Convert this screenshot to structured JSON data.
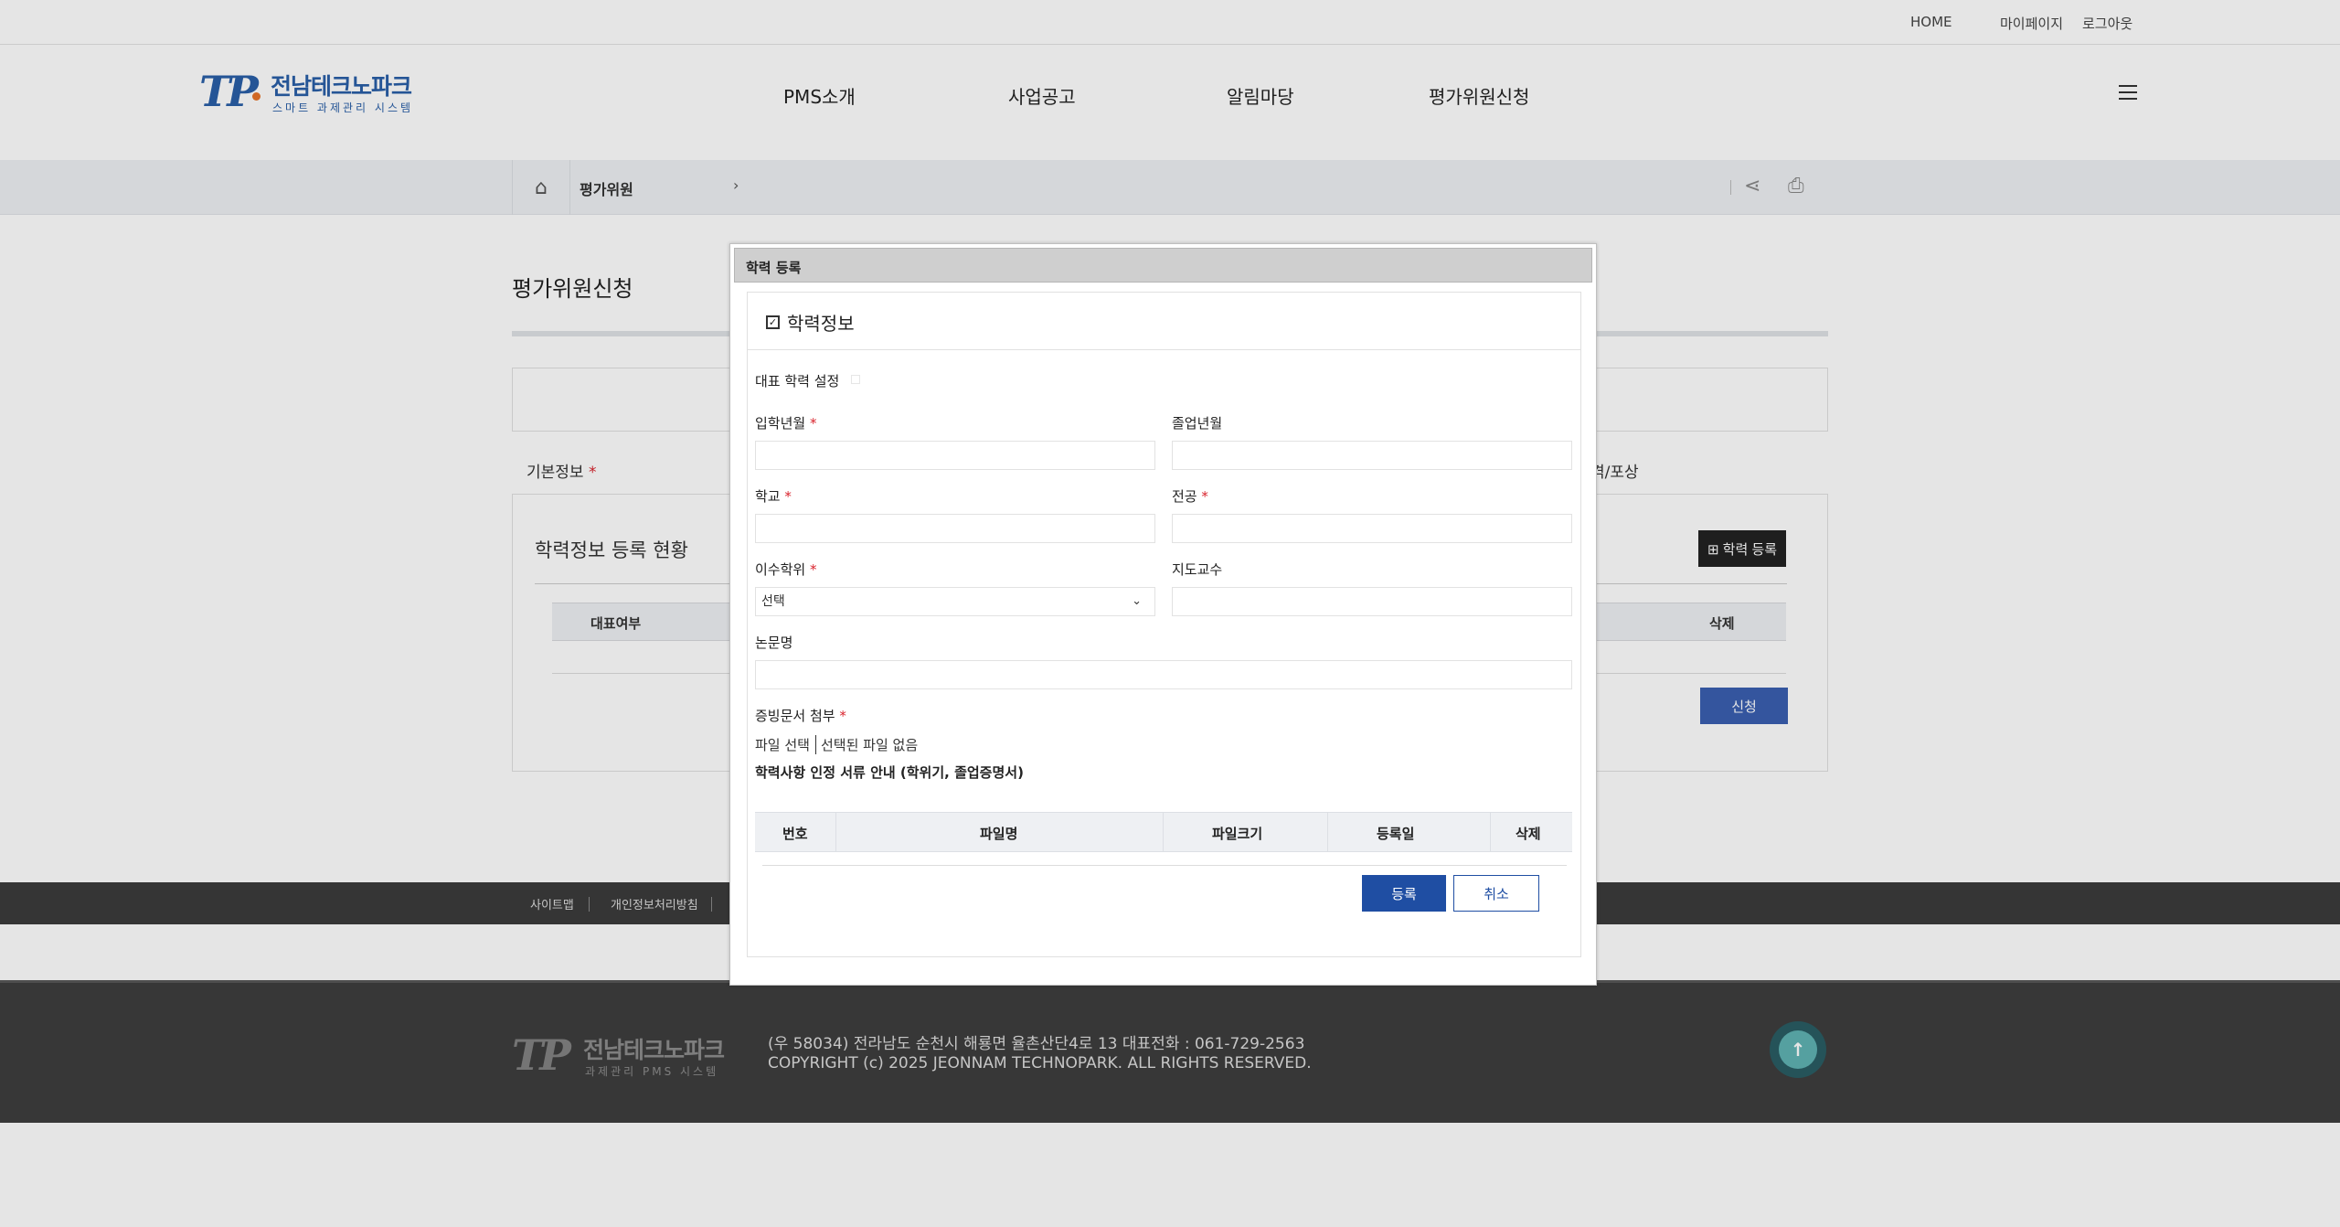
{
  "topbar": {
    "home": "HOME",
    "mypage": "마이페이지",
    "logout": "로그아웃"
  },
  "logo": {
    "mark": "TP",
    "name": "전남테크노파크",
    "sub": "스마트 과제관리 시스템"
  },
  "gnb": [
    "PMS소개",
    "사업공고",
    "알림마당",
    "평가위원신청"
  ],
  "breadcrumb": {
    "current": "평가위원",
    "arrow": "›"
  },
  "page": {
    "title": "평가위원신청",
    "tab_basic": "기본정보",
    "tab_award": "격/포상",
    "required_mark": "*",
    "edu_title": "학력정보 등록 현황",
    "add_edu_button": "⊞ 학력 등록",
    "edu_table_headers": [
      "대표여부",
      "삭제"
    ],
    "apply_button": "신청"
  },
  "footer_links": [
    "사이트맵",
    "개인정보처리방침"
  ],
  "footer": {
    "logo_name": "전남테크노파크",
    "logo_sub": "과제관리 PMS 시스템",
    "address": "(우 58034) 전라남도 순천시 해룡면 율촌산단4로 13   대표전화 : 061-729-2563",
    "copyright": "COPYRIGHT (c) 2025 JEONNAM TECHNOPARK. ALL RIGHTS RESERVED."
  },
  "modal": {
    "title": "학력 등록",
    "section_title": "학력정보",
    "rep_setting": "대표 학력 설정",
    "labels": {
      "admission": "입학년월",
      "graduation": "졸업년월",
      "school": "학교",
      "major": "전공",
      "degree": "이수학위",
      "advisor": "지도교수",
      "thesis": "논문명",
      "attach": "증빙문서 첨부"
    },
    "degree_selected": "선택",
    "file_button": "파일 선택",
    "file_none": "선택된 파일 없음",
    "guide": "학력사항 인정 서류 안내 (학위기, 졸업증명서)",
    "file_table_headers": [
      "번호",
      "파일명",
      "파일크기",
      "등록일",
      "삭제"
    ],
    "register_button": "등록",
    "cancel_button": "취소"
  }
}
